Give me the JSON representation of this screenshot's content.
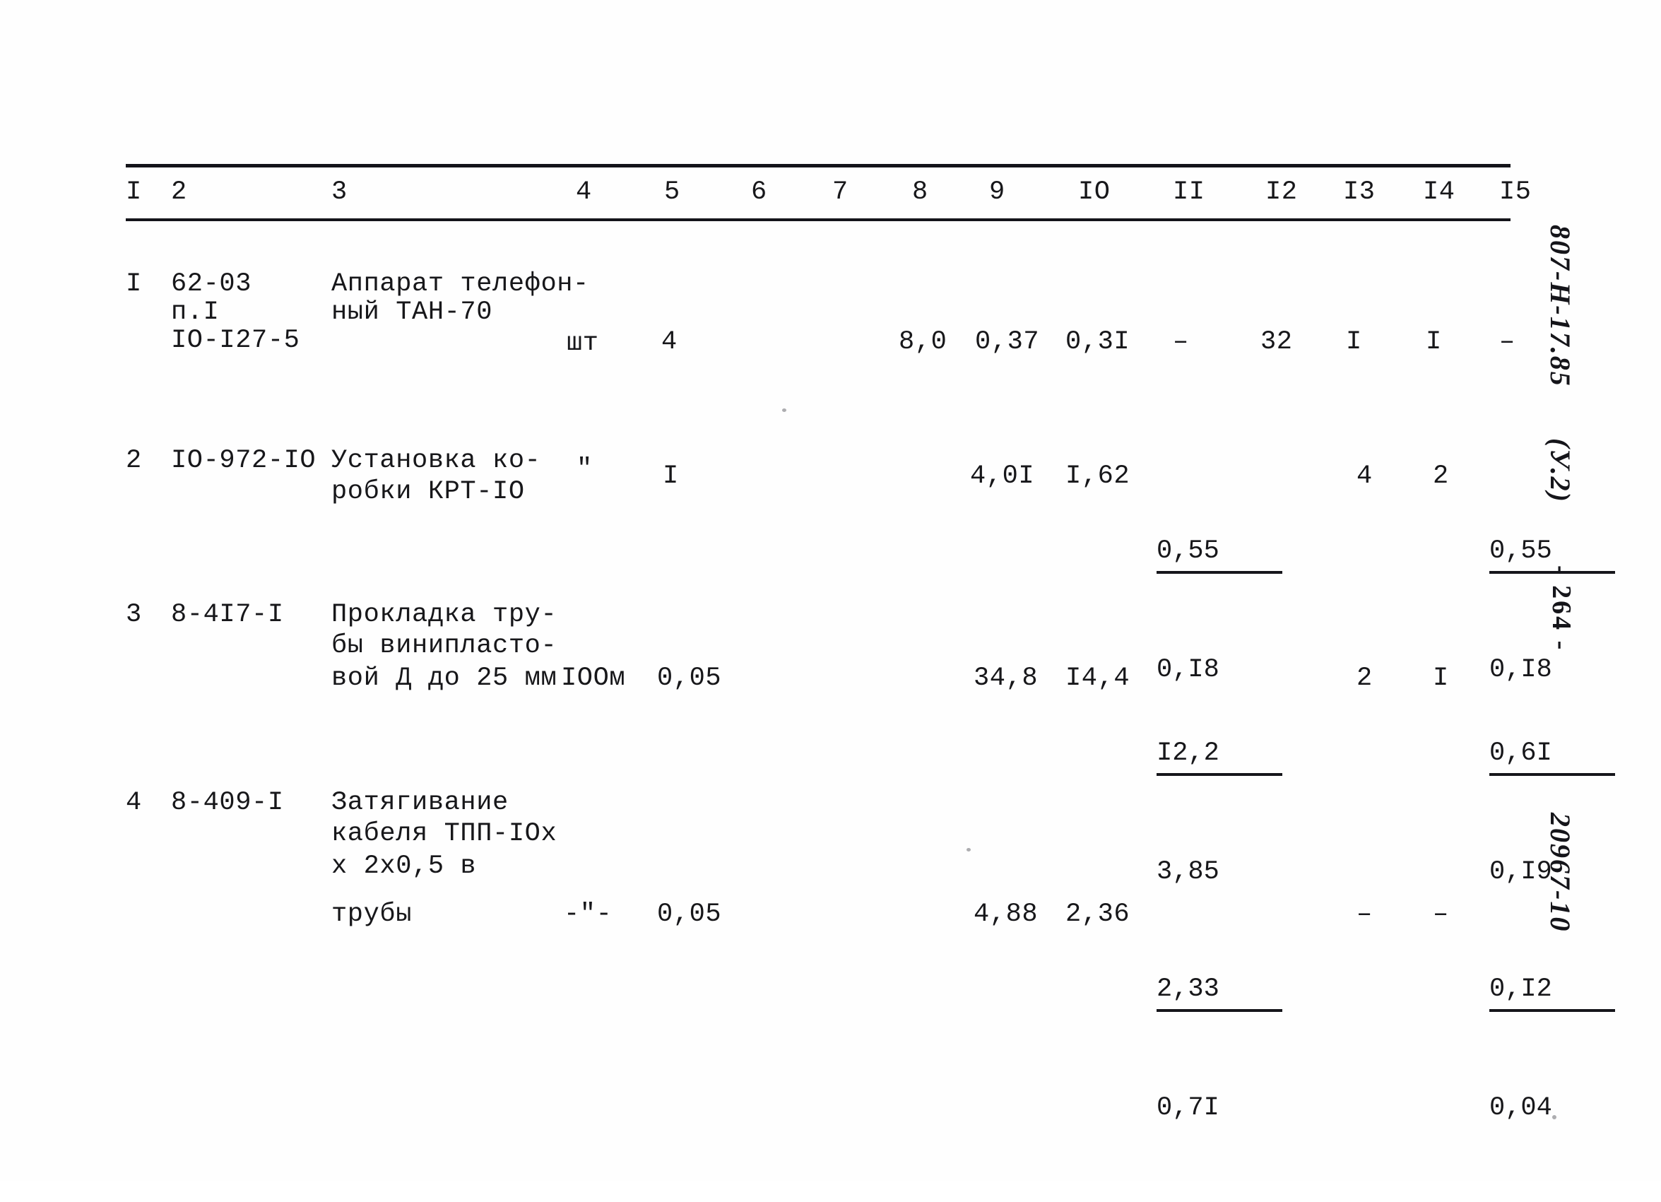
{
  "document": {
    "type": "scanned-estimate-table",
    "language": "ru"
  },
  "table": {
    "column_headers": [
      "I",
      "2",
      "3",
      "4",
      "5",
      "6",
      "7",
      "8",
      "9",
      "IO",
      "II",
      "I2",
      "I3",
      "I4",
      "I5"
    ],
    "rows": [
      {
        "c1": "I",
        "c2_line1": "62-03",
        "c2_line2": "п.I",
        "c2_line3": "IO-I27-5",
        "c3_line1": "Аппарат телефон-",
        "c3_line2": "ный ТАН-70",
        "c3_line3": "",
        "c3_line4": "",
        "c4": "шт",
        "c5": "4",
        "c6": "",
        "c7": "",
        "c8": "8,0",
        "c9": "0,37",
        "c10": "0,3I",
        "c11_num": "–",
        "c11_den": "",
        "c12": "32",
        "c13": "I",
        "c14": "I",
        "c15_num": "–",
        "c15_den": ""
      },
      {
        "c1": "2",
        "c2_line1": "IO-972-IO",
        "c2_line2": "",
        "c2_line3": "",
        "c3_line1": "Установка ко-",
        "c3_line2": "робки КРТ-IO",
        "c3_line3": "",
        "c3_line4": "",
        "c4": "\"",
        "c5": "I",
        "c6": "",
        "c7": "",
        "c8": "",
        "c9": "4,0I",
        "c10": "I,62",
        "c11_num": "0,55",
        "c11_den": "0,I8",
        "c12": "",
        "c13": "4",
        "c14": "2",
        "c15_num": "0,55",
        "c15_den": "0,I8"
      },
      {
        "c1": "3",
        "c2_line1": "8-4I7-I",
        "c2_line2": "",
        "c2_line3": "",
        "c3_line1": "Прокладка тру-",
        "c3_line2": "бы винипласто-",
        "c3_line3": "вой Д до 25 мм",
        "c3_line4": "",
        "c4": "IOOм",
        "c5": "0,05",
        "c6": "",
        "c7": "",
        "c8": "",
        "c9": "34,8",
        "c10": "I4,4",
        "c11_num": "I2,2",
        "c11_den": "3,85",
        "c12": "",
        "c13": "2",
        "c14": "I",
        "c15_num": "0,6I",
        "c15_den": "0,I9"
      },
      {
        "c1": "4",
        "c2_line1": "8-409-I",
        "c2_line2": "",
        "c2_line3": "",
        "c3_line1": "Затягивание",
        "c3_line2": "кабеля ТПП-IOх",
        "c3_line3": "х 2х0,5 в",
        "c3_line4": "трубы",
        "c4": "-\"-",
        "c5": "0,05",
        "c6": "",
        "c7": "",
        "c8": "",
        "c9": "4,88",
        "c10": "2,36",
        "c11_num": "2,33",
        "c11_den": "0,7I",
        "c12": "",
        "c13": "–",
        "c14": "–",
        "c15_num": "0,I2",
        "c15_den": "0,04"
      }
    ]
  },
  "margin_notes": {
    "stamp_code": "807-Н-17.85",
    "stamp_revision": "(У.2)",
    "stamp_page": "- 264 -",
    "stamp_doc": "20967-10"
  }
}
